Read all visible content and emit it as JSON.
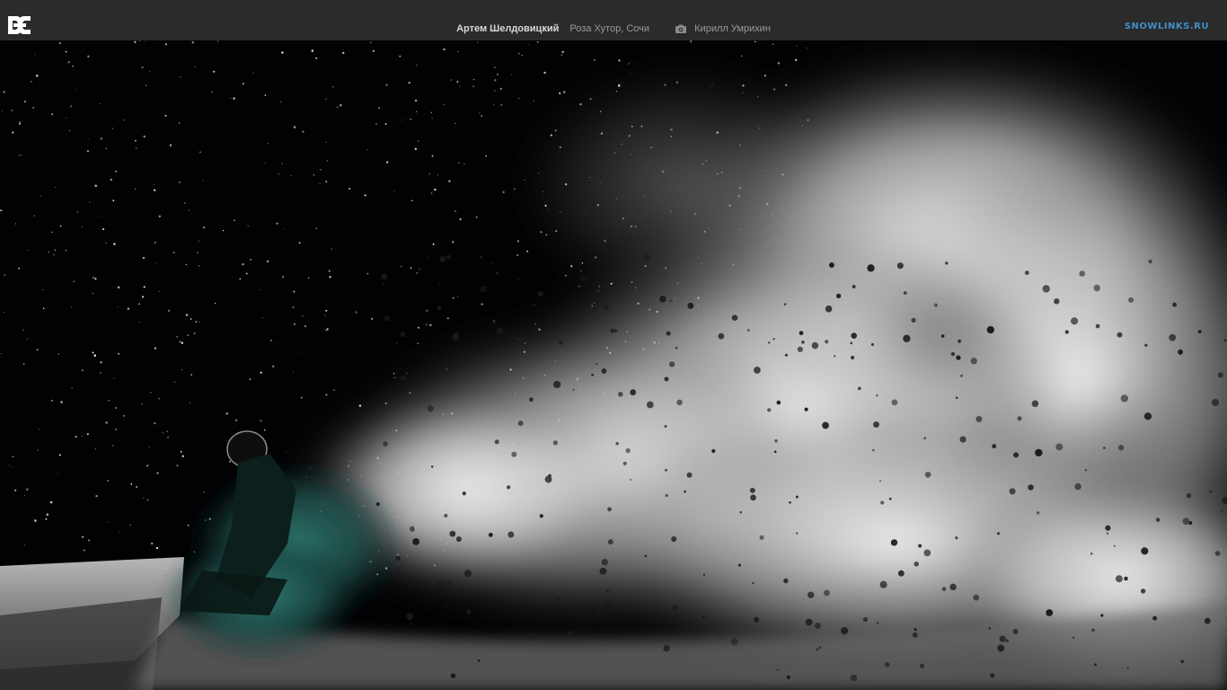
{
  "header": {
    "logo_icon": "dc-shoes-logo-icon",
    "rider_name": "Артем Шелдовицкий",
    "location": "Роза Хутор, Сочи",
    "camera_icon": "camera-icon",
    "photographer": "Кирилл Умрихин",
    "site_brand": "snowlinks.ru"
  },
  "colors": {
    "topbar": "#2b2b2b",
    "brand": "#3f8fc7",
    "rider_text": "#d8d8d8",
    "secondary_text": "#9a9a9a"
  }
}
